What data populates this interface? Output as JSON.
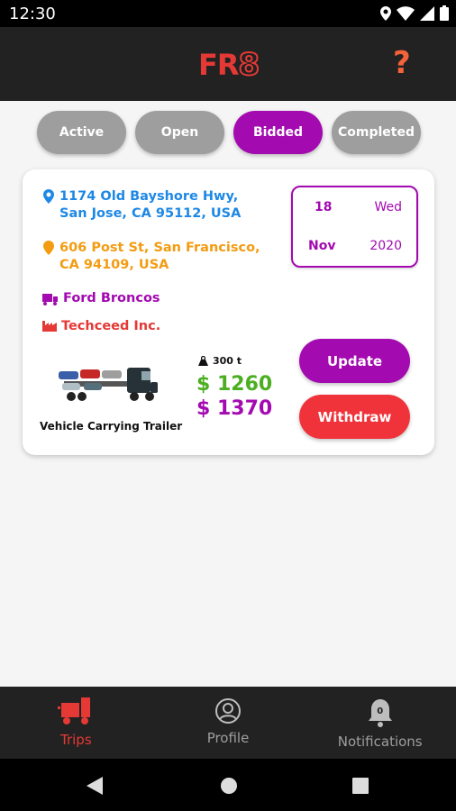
{
  "status": {
    "time": "12:30"
  },
  "header": {
    "logo_text": "FR",
    "logo_num": "8",
    "help_icon": "?"
  },
  "tabs": [
    {
      "label": "Active",
      "selected": false
    },
    {
      "label": "Open",
      "selected": false
    },
    {
      "label": "Bidded",
      "selected": true
    },
    {
      "label": "Completed",
      "selected": false
    }
  ],
  "trip": {
    "pickup": "1174 Old Bayshore Hwy, San Jose, CA 95112, USA",
    "dropoff": "606 Post St, San Francisco, CA 94109, USA",
    "vehicle": "Ford Broncos",
    "company": "Techceed Inc.",
    "date": {
      "day": "18",
      "weekday": "Wed",
      "month": "Nov",
      "year": "2020"
    },
    "trailer_type": "Vehicle Carrying Trailer",
    "weight": "300 t",
    "price_offer": "$ 1260",
    "price_bid": "$ 1370",
    "update_label": "Update",
    "withdraw_label": "Withdraw"
  },
  "nav": {
    "trips": "Trips",
    "profile": "Profile",
    "notifications": "Notifications",
    "notification_count": "0"
  },
  "colors": {
    "accent": "#a30ab0",
    "brand": "#e53935",
    "pickup": "#1e88e5",
    "dropoff": "#f39c12",
    "price_green": "#4caf23"
  }
}
